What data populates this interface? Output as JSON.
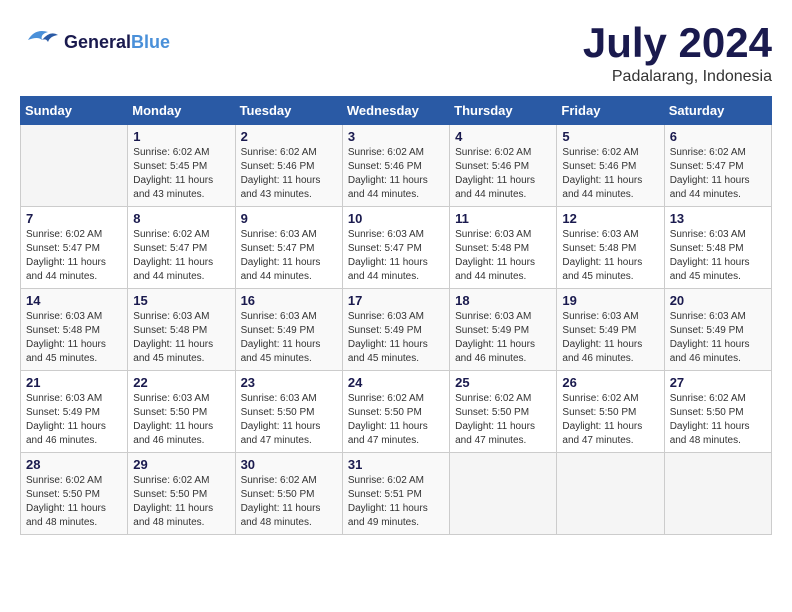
{
  "header": {
    "logo_general": "General",
    "logo_blue": "Blue",
    "month_year": "July 2024",
    "location": "Padalarang, Indonesia"
  },
  "weekdays": [
    "Sunday",
    "Monday",
    "Tuesday",
    "Wednesday",
    "Thursday",
    "Friday",
    "Saturday"
  ],
  "weeks": [
    [
      {
        "day": "",
        "info": ""
      },
      {
        "day": "1",
        "info": "Sunrise: 6:02 AM\nSunset: 5:45 PM\nDaylight: 11 hours\nand 43 minutes."
      },
      {
        "day": "2",
        "info": "Sunrise: 6:02 AM\nSunset: 5:46 PM\nDaylight: 11 hours\nand 43 minutes."
      },
      {
        "day": "3",
        "info": "Sunrise: 6:02 AM\nSunset: 5:46 PM\nDaylight: 11 hours\nand 44 minutes."
      },
      {
        "day": "4",
        "info": "Sunrise: 6:02 AM\nSunset: 5:46 PM\nDaylight: 11 hours\nand 44 minutes."
      },
      {
        "day": "5",
        "info": "Sunrise: 6:02 AM\nSunset: 5:46 PM\nDaylight: 11 hours\nand 44 minutes."
      },
      {
        "day": "6",
        "info": "Sunrise: 6:02 AM\nSunset: 5:47 PM\nDaylight: 11 hours\nand 44 minutes."
      }
    ],
    [
      {
        "day": "7",
        "info": "Sunrise: 6:02 AM\nSunset: 5:47 PM\nDaylight: 11 hours\nand 44 minutes."
      },
      {
        "day": "8",
        "info": "Sunrise: 6:02 AM\nSunset: 5:47 PM\nDaylight: 11 hours\nand 44 minutes."
      },
      {
        "day": "9",
        "info": "Sunrise: 6:03 AM\nSunset: 5:47 PM\nDaylight: 11 hours\nand 44 minutes."
      },
      {
        "day": "10",
        "info": "Sunrise: 6:03 AM\nSunset: 5:47 PM\nDaylight: 11 hours\nand 44 minutes."
      },
      {
        "day": "11",
        "info": "Sunrise: 6:03 AM\nSunset: 5:48 PM\nDaylight: 11 hours\nand 44 minutes."
      },
      {
        "day": "12",
        "info": "Sunrise: 6:03 AM\nSunset: 5:48 PM\nDaylight: 11 hours\nand 45 minutes."
      },
      {
        "day": "13",
        "info": "Sunrise: 6:03 AM\nSunset: 5:48 PM\nDaylight: 11 hours\nand 45 minutes."
      }
    ],
    [
      {
        "day": "14",
        "info": "Sunrise: 6:03 AM\nSunset: 5:48 PM\nDaylight: 11 hours\nand 45 minutes."
      },
      {
        "day": "15",
        "info": "Sunrise: 6:03 AM\nSunset: 5:48 PM\nDaylight: 11 hours\nand 45 minutes."
      },
      {
        "day": "16",
        "info": "Sunrise: 6:03 AM\nSunset: 5:49 PM\nDaylight: 11 hours\nand 45 minutes."
      },
      {
        "day": "17",
        "info": "Sunrise: 6:03 AM\nSunset: 5:49 PM\nDaylight: 11 hours\nand 45 minutes."
      },
      {
        "day": "18",
        "info": "Sunrise: 6:03 AM\nSunset: 5:49 PM\nDaylight: 11 hours\nand 46 minutes."
      },
      {
        "day": "19",
        "info": "Sunrise: 6:03 AM\nSunset: 5:49 PM\nDaylight: 11 hours\nand 46 minutes."
      },
      {
        "day": "20",
        "info": "Sunrise: 6:03 AM\nSunset: 5:49 PM\nDaylight: 11 hours\nand 46 minutes."
      }
    ],
    [
      {
        "day": "21",
        "info": "Sunrise: 6:03 AM\nSunset: 5:49 PM\nDaylight: 11 hours\nand 46 minutes."
      },
      {
        "day": "22",
        "info": "Sunrise: 6:03 AM\nSunset: 5:50 PM\nDaylight: 11 hours\nand 46 minutes."
      },
      {
        "day": "23",
        "info": "Sunrise: 6:03 AM\nSunset: 5:50 PM\nDaylight: 11 hours\nand 47 minutes."
      },
      {
        "day": "24",
        "info": "Sunrise: 6:02 AM\nSunset: 5:50 PM\nDaylight: 11 hours\nand 47 minutes."
      },
      {
        "day": "25",
        "info": "Sunrise: 6:02 AM\nSunset: 5:50 PM\nDaylight: 11 hours\nand 47 minutes."
      },
      {
        "day": "26",
        "info": "Sunrise: 6:02 AM\nSunset: 5:50 PM\nDaylight: 11 hours\nand 47 minutes."
      },
      {
        "day": "27",
        "info": "Sunrise: 6:02 AM\nSunset: 5:50 PM\nDaylight: 11 hours\nand 48 minutes."
      }
    ],
    [
      {
        "day": "28",
        "info": "Sunrise: 6:02 AM\nSunset: 5:50 PM\nDaylight: 11 hours\nand 48 minutes."
      },
      {
        "day": "29",
        "info": "Sunrise: 6:02 AM\nSunset: 5:50 PM\nDaylight: 11 hours\nand 48 minutes."
      },
      {
        "day": "30",
        "info": "Sunrise: 6:02 AM\nSunset: 5:50 PM\nDaylight: 11 hours\nand 48 minutes."
      },
      {
        "day": "31",
        "info": "Sunrise: 6:02 AM\nSunset: 5:51 PM\nDaylight: 11 hours\nand 49 minutes."
      },
      {
        "day": "",
        "info": ""
      },
      {
        "day": "",
        "info": ""
      },
      {
        "day": "",
        "info": ""
      }
    ]
  ]
}
